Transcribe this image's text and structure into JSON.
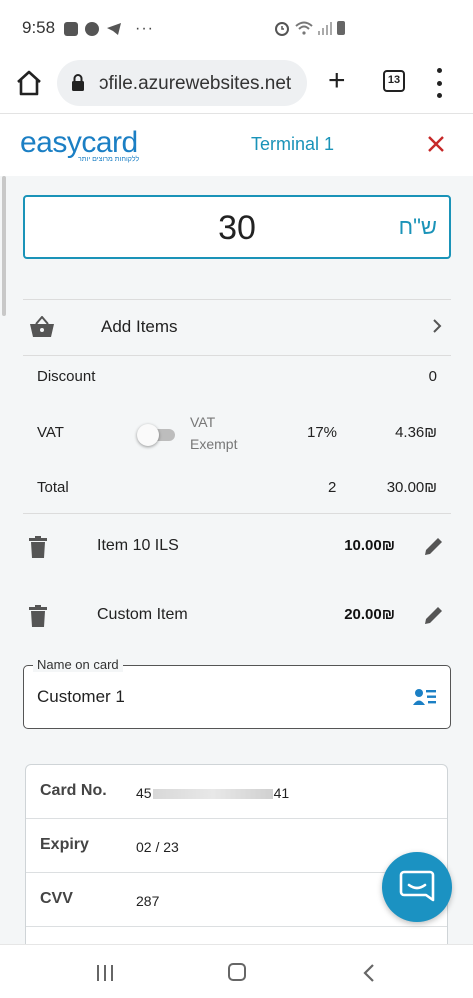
{
  "status_bar": {
    "time": "9:58",
    "overflow": "···"
  },
  "browser": {
    "url": "ɔfile.azurewebsites.net",
    "tab_count": "13",
    "new_tab": "+"
  },
  "app_header": {
    "logo": "easycard",
    "logo_tagline": "ללקוחות מרוצים יותר",
    "terminal": "Terminal 1"
  },
  "amount": {
    "value": "30",
    "currency": "ש\"ח"
  },
  "add_items": {
    "label": "Add Items"
  },
  "summary": {
    "discount_label": "Discount",
    "discount_value": "0",
    "vat_label": "VAT",
    "vat_exempt_label": "VAT Exempt",
    "vat_exempt_on": false,
    "vat_rate": "17%",
    "vat_amount": "4.36₪",
    "total_label": "Total",
    "total_count": "2",
    "total_amount": "30.00₪"
  },
  "items": [
    {
      "name": "Item 10 ILS",
      "price": "10.00₪"
    },
    {
      "name": "Custom Item",
      "price": "20.00₪"
    }
  ],
  "customer": {
    "legend": "Name on card",
    "value": "Customer 1"
  },
  "card": {
    "number_label": "Card No.",
    "number_prefix": "45",
    "number_suffix": "41",
    "expiry_label": "Expiry",
    "expiry_value": "02 / 23",
    "cvv_label": "CVV",
    "cvv_value": "287"
  },
  "colors": {
    "accent": "#1a93b8",
    "brand": "#1b7fc4",
    "close": "#c62828",
    "fab": "#1b92c2"
  },
  "icons": {
    "basket": "basket-icon",
    "trash": "trash-icon",
    "edit": "pencil-icon",
    "contact": "contact-list-icon",
    "chat": "chat-icon"
  }
}
